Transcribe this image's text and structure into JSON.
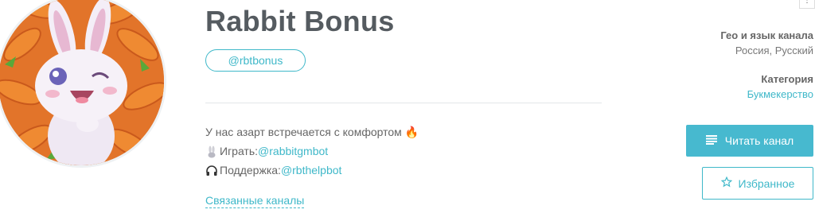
{
  "channel": {
    "title": "Rabbit Bonus",
    "handle": "@rbtbonus"
  },
  "description": {
    "line1": "У нас азарт встречается с комфортом",
    "line1_emoji": "🔥",
    "line2_prefix": "Играть: ",
    "line2_link": "@rabbitgmbot",
    "line3_prefix": "Поддержка: ",
    "line3_link": "@rbthelpbot"
  },
  "related_label": "Связанные каналы",
  "meta": {
    "geo_label": "Гео и язык канала",
    "geo_value": "Россия, Русский",
    "category_label": "Категория",
    "category_value": "Букмекерство"
  },
  "actions": {
    "read_label": "Читать канал",
    "favorite_label": "Избранное"
  },
  "icons": {
    "read": "list-icon",
    "favorite": "star-icon",
    "play": "rabbit-icon",
    "support": "headphones-icon"
  },
  "colors": {
    "accent": "#3fb8c9",
    "button_fill": "#47b9cf",
    "title": "#555b60"
  }
}
